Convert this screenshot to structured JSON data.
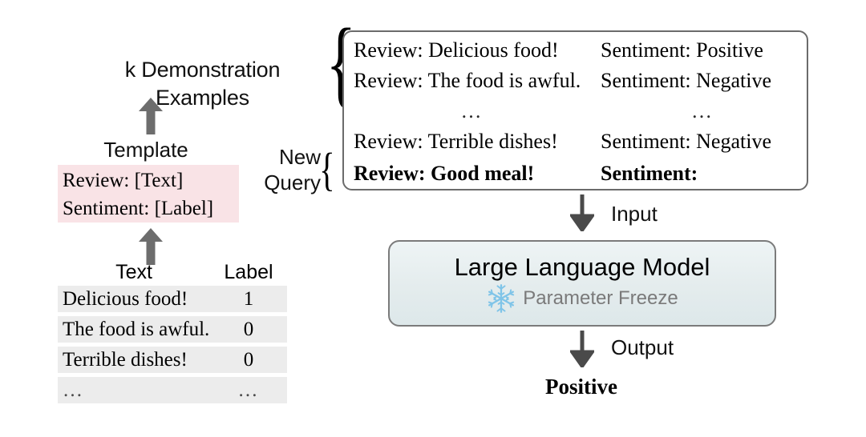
{
  "labels": {
    "k_demonstration": "k Demonstration\nExamples",
    "k_demonstration_line1": "k Demonstration",
    "k_demonstration_line2": "Examples",
    "template": "Template",
    "new_query_line1": "New",
    "new_query_line2": "Query",
    "input": "Input",
    "output": "Output"
  },
  "template_box": {
    "line1": "Review: [Text]",
    "line2": "Sentiment: [Label]",
    "background_color": "#f9e3e6"
  },
  "data_table": {
    "headers": [
      "Text",
      "Label"
    ],
    "rows": [
      {
        "text": "Delicious food!",
        "label": "1"
      },
      {
        "text": "The food is awful.",
        "label": "0"
      },
      {
        "text": "Terrible dishes!",
        "label": "0"
      },
      {
        "text": "…",
        "label": "…"
      }
    ],
    "row_background_color": "#ececec"
  },
  "prompt_box": {
    "rows": [
      {
        "review": "Review: Delicious food!",
        "sentiment": "Sentiment: Positive",
        "bold": false
      },
      {
        "review": "Review: The food is awful.",
        "sentiment": "Sentiment: Negative",
        "bold": false
      },
      {
        "review": "…",
        "sentiment": "…",
        "bold": false
      },
      {
        "review": "Review: Terrible dishes!",
        "sentiment": "Sentiment: Negative",
        "bold": false
      },
      {
        "review": "Review: Good meal!",
        "sentiment": "Sentiment:",
        "bold": true
      }
    ],
    "border_color": "#6b6b6b"
  },
  "braces": {
    "demonstration": "{",
    "query": "{"
  },
  "llm": {
    "title": "Large Language Model",
    "freeze_label": "Parameter Freeze",
    "freeze_icon": "snowflake-icon",
    "icon_color": "#7fc4e8",
    "border_color": "#7b7b7b",
    "background_color": "#e6eef0",
    "freeze_text_color": "#7a7a7a"
  },
  "output": {
    "value": "Positive"
  },
  "arrows": {
    "color": "#6d6d6d",
    "dark_color": "#4a4a4a"
  }
}
